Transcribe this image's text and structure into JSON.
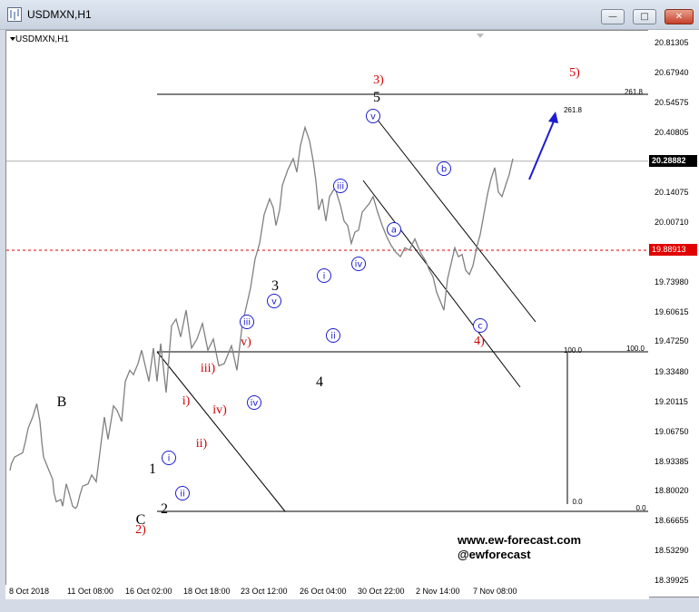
{
  "window": {
    "title": "USDMXN,H1",
    "min_glyph": "—",
    "max_glyph": "□",
    "close_glyph": "✕"
  },
  "chart": {
    "label": "USDMXN,H1",
    "price_ticks": [
      "20.81305",
      "20.67940",
      "20.54575",
      "20.40805",
      "20.28882",
      "20.14075",
      "20.00710",
      "19.87345",
      "19.73980",
      "19.60615",
      "19.47250",
      "19.33480",
      "19.20115",
      "19.06750",
      "18.93385",
      "18.80020",
      "18.66655",
      "18.53290",
      "18.39925"
    ],
    "current_price": "20.28882",
    "reference_price": "19.88913",
    "time_ticks": [
      "8 Oct 2018",
      "11 Oct 08:00",
      "16 Oct 02:00",
      "18 Oct 18:00",
      "23 Oct 12:00",
      "26 Oct 04:00",
      "30 Oct 22:00",
      "2 Nov 14:00",
      "7 Nov 08:00"
    ],
    "colors": {
      "candles": "#808080",
      "wave_blue": "#1c1cd0",
      "wave_red": "#d00000",
      "current_line": "#b0b0b0",
      "red_dashed": "#e00000",
      "arrow": "#1c1cd0"
    }
  },
  "fib": {
    "upper_left": "261.8",
    "upper_target": "261.8",
    "mid_left": "100.0",
    "mid_right": "100.0",
    "low_left": "0.0",
    "low_right": "0.0"
  },
  "waves": {
    "black": [
      "B",
      "C",
      "1",
      "2",
      "3",
      "4",
      "5"
    ],
    "red": [
      "2)",
      "i)",
      "ii)",
      "iii)",
      "iv)",
      "v)",
      "3)",
      "4)",
      "5)"
    ],
    "blue_circled": [
      "i",
      "ii",
      "iii",
      "iv",
      "v",
      "i",
      "ii",
      "iii",
      "iv",
      "v",
      "a",
      "b",
      "c"
    ]
  },
  "watermark": {
    "url": "www.ew-forecast.com",
    "handle": "@ewforecast"
  },
  "chart_data": {
    "type": "line",
    "symbol": "USDMXN",
    "timeframe": "H1",
    "x_ticks": [
      "8 Oct 2018",
      "11 Oct 08:00",
      "16 Oct 02:00",
      "18 Oct 18:00",
      "23 Oct 12:00",
      "26 Oct 04:00",
      "30 Oct 22:00",
      "2 Nov 14:00",
      "7 Nov 08:00"
    ],
    "ylim": [
      18.39925,
      20.81305
    ],
    "x_approx_index": [
      0,
      1.5,
      5,
      14,
      17,
      20,
      25,
      28,
      29.5,
      33,
      35,
      37,
      43,
      47,
      48.5,
      51,
      56,
      58,
      62,
      65,
      69,
      72,
      74,
      77,
      80,
      86,
      90,
      95,
      99,
      104,
      108,
      114,
      118,
      123,
      127,
      132,
      136,
      141,
      145,
      149,
      153,
      158,
      162,
      166,
      172,
      178,
      183,
      188,
      194,
      200,
      206,
      212,
      218,
      224,
      230,
      236,
      244,
      250,
      256,
      260,
      265,
      270,
      275,
      280,
      286,
      290,
      293,
      297,
      300,
      306,
      312,
      316,
      320,
      325,
      330,
      334,
      337,
      340,
      344,
      348,
      352,
      358,
      364,
      368,
      372,
      376,
      380,
      384,
      388,
      392,
      396,
      400,
      405,
      410,
      415,
      420,
      425,
      430,
      435,
      440,
      446,
      452,
      458,
      462,
      466,
      470,
      474,
      478,
      482,
      486,
      490,
      494,
      498,
      502,
      506,
      510,
      514,
      518,
      522,
      526,
      530,
      534,
      538,
      542,
      546,
      550,
      554,
      558,
      562,
      566,
      570
    ],
    "values": [
      18.9,
      18.93,
      18.96,
      18.98,
      19.03,
      19.09,
      19.14,
      19.18,
      19.2,
      19.12,
      19.03,
      18.96,
      18.9,
      18.86,
      18.8,
      18.76,
      18.77,
      18.74,
      18.84,
      18.8,
      18.74,
      18.73,
      18.74,
      18.79,
      18.83,
      18.84,
      18.88,
      18.85,
      18.98,
      19.14,
      19.04,
      19.19,
      19.17,
      19.12,
      19.3,
      19.35,
      19.33,
      19.38,
      19.44,
      19.37,
      19.3,
      19.45,
      19.3,
      19.47,
      19.25,
      19.55,
      19.58,
      19.5,
      19.62,
      19.45,
      19.49,
      19.56,
      19.44,
      19.49,
      19.37,
      19.38,
      19.46,
      19.35,
      19.56,
      19.63,
      19.72,
      19.85,
      19.92,
      20.05,
      20.12,
      20.08,
      20.0,
      20.07,
      20.18,
      20.25,
      20.3,
      20.24,
      20.36,
      20.44,
      20.38,
      20.29,
      20.2,
      20.07,
      20.12,
      20.02,
      20.13,
      20.17,
      20.09,
      20.02,
      20.0,
      19.92,
      19.97,
      19.98,
      20.06,
      20.08,
      20.1,
      20.13,
      20.06,
      20.0,
      19.95,
      19.91,
      19.88,
      19.86,
      19.9,
      19.89,
      19.94,
      19.88,
      19.84,
      19.8,
      19.77,
      19.7,
      19.66,
      19.62,
      19.76,
      19.83,
      19.9,
      19.86,
      19.87,
      19.8,
      19.78,
      19.82,
      19.9,
      19.96,
      20.05,
      20.14,
      20.21,
      20.26,
      20.15,
      20.13,
      20.18,
      20.23,
      20.3
    ]
  }
}
